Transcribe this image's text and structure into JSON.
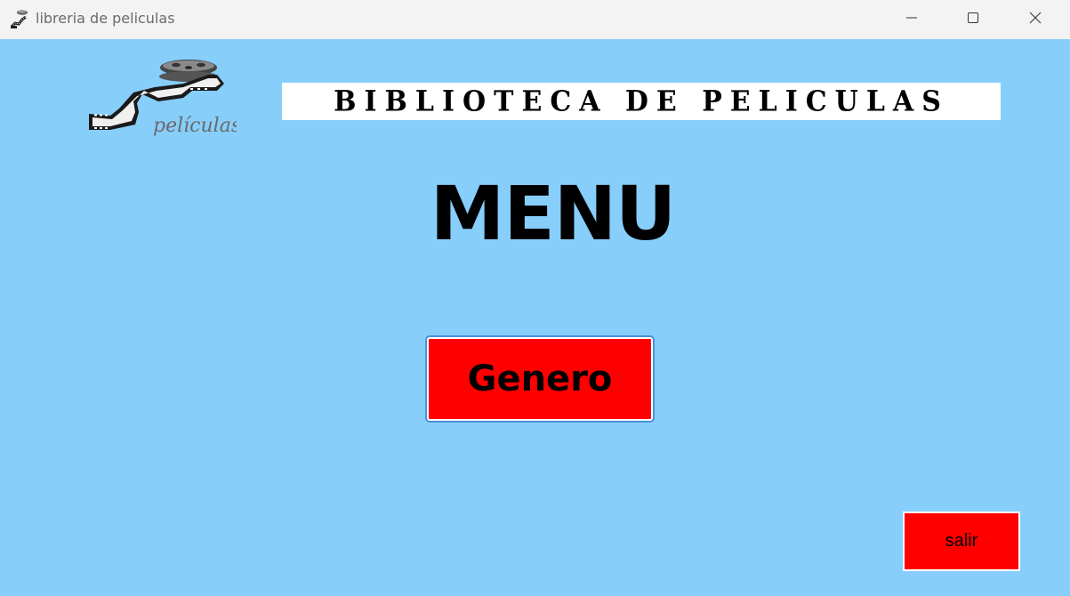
{
  "window": {
    "title": "libreria de peliculas",
    "app_icon": "film-reel-icon",
    "controls": {
      "minimize_icon": "minimize-icon",
      "maximize_icon": "maximize-icon",
      "close_icon": "close-icon"
    }
  },
  "header": {
    "logo_text": "películas",
    "banner_text": "BIBLIOTECA DE PELICULAS"
  },
  "main": {
    "title": "MENU",
    "genero_label": "Genero",
    "salir_label": "salir"
  },
  "colors": {
    "background": "#87cefa",
    "button": "#ff0000",
    "titlebar": "#f3f3f3",
    "banner": "#ffffff"
  }
}
